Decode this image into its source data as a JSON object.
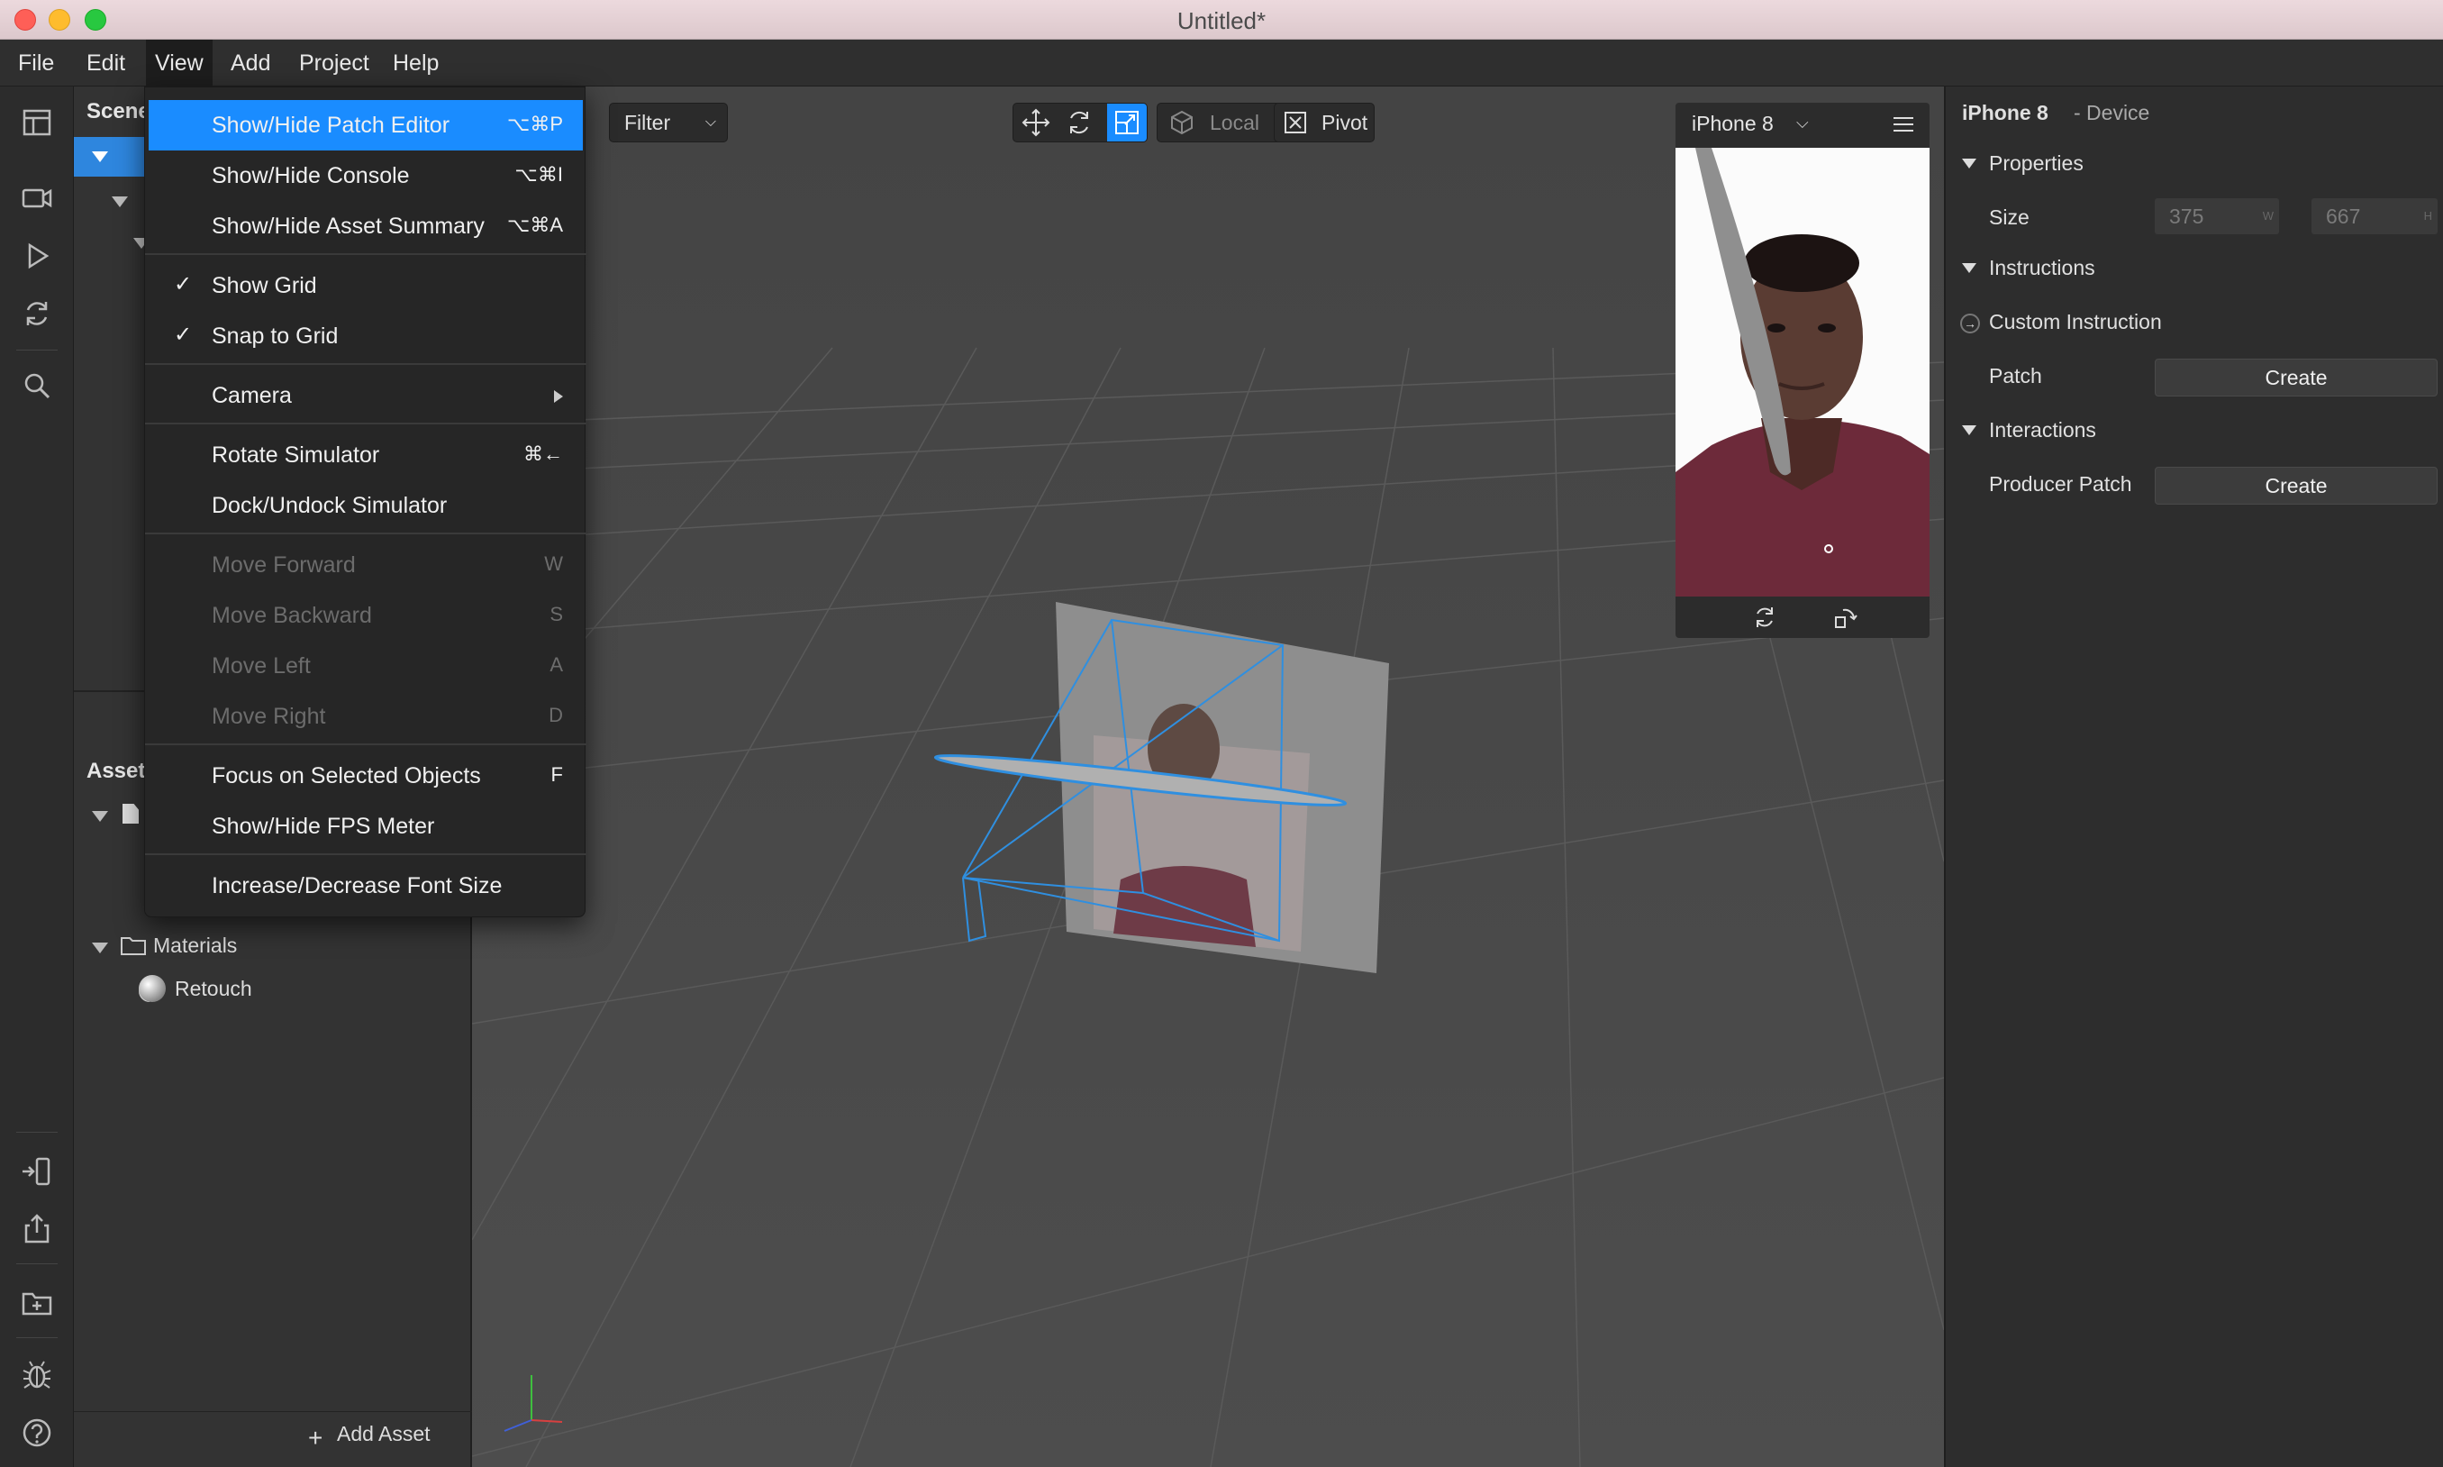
{
  "window": {
    "title": "Untitled*"
  },
  "menubar": [
    "File",
    "Edit",
    "View",
    "Add",
    "Project",
    "Help"
  ],
  "view_menu": {
    "items": [
      {
        "label": "Show/Hide Patch Editor",
        "shortcut": "⌥⌘P",
        "highlighted": true
      },
      {
        "label": "Show/Hide Console",
        "shortcut": "⌥⌘I"
      },
      {
        "label": "Show/Hide Asset Summary",
        "shortcut": "⌥⌘A"
      },
      {
        "label": "Show Grid",
        "checked": true
      },
      {
        "label": "Snap to Grid",
        "checked": true
      },
      {
        "label": "Camera",
        "submenu": true
      },
      {
        "label": "Rotate Simulator",
        "shortcut": "⌘←"
      },
      {
        "label": "Dock/Undock Simulator"
      },
      {
        "label": "Move Forward",
        "shortcut": "W",
        "disabled": true
      },
      {
        "label": "Move Backward",
        "shortcut": "S",
        "disabled": true
      },
      {
        "label": "Move Left",
        "shortcut": "A",
        "disabled": true
      },
      {
        "label": "Move Right",
        "shortcut": "D",
        "disabled": true
      },
      {
        "label": "Focus on Selected Objects",
        "shortcut": "F"
      },
      {
        "label": "Show/Hide FPS Meter"
      },
      {
        "label": "Increase/Decrease Font Size"
      }
    ],
    "checkmark": "✓"
  },
  "scene_panel": {
    "title": "Scene"
  },
  "assets_panel": {
    "title": "Asset",
    "folders": [
      {
        "label": "Materials",
        "children": [
          "Retouch"
        ]
      }
    ],
    "add_asset_label": "Add Asset"
  },
  "viewport_toolbar": {
    "filter_label": "Filter",
    "local_label": "Local",
    "pivot_label": "Pivot"
  },
  "simulator": {
    "device": "iPhone 8"
  },
  "inspector": {
    "device_name": "iPhone 8",
    "device_type": "- Device",
    "properties": {
      "section": "Properties",
      "size_label": "Size",
      "width": "375",
      "width_unit": "W",
      "height": "667",
      "height_unit": "H"
    },
    "instructions": {
      "section": "Instructions",
      "custom_label": "Custom Instruction",
      "patch_label": "Patch",
      "create_label": "Create"
    },
    "interactions": {
      "section": "Interactions",
      "producer_label": "Producer Patch",
      "create_label": "Create"
    }
  },
  "colors": {
    "accent": "#1a8cff",
    "selection": "#2e86de",
    "gizmo": "#2f8fe0"
  }
}
